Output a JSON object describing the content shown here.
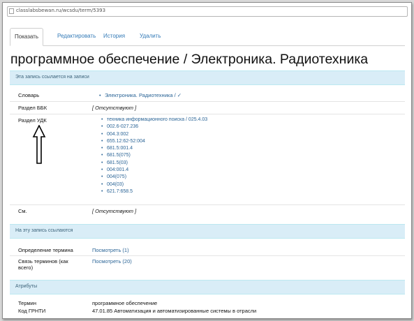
{
  "browser": {
    "url": "classlabsbewan.ru/wcsdu/term/5393"
  },
  "tabs": [
    {
      "label": "Показать"
    },
    {
      "label": "Редактировать"
    },
    {
      "label": "История"
    },
    {
      "label": "Удалить"
    }
  ],
  "page_title": "программное обеспечение / Электроника. Радиотехника",
  "section_refs_out": {
    "header": "Эта запись ссылается на записи",
    "dictionary_label": "Словарь",
    "dictionary_value": "Электроника. Радиотехника / ✓",
    "bbk_label": "Раздел ББК",
    "bbk_value": "[ Отсутствуют ]",
    "udk_label": "Раздел УДК",
    "udk_values": [
      "техника информационного поиска / 025.4.03",
      "002.6-027.236",
      "004.3:002",
      "655.12:62-52:004",
      "681.5:001.4",
      "681.5(075)",
      "681.5(03)",
      "004:001.4",
      "004(075)",
      "004(03)",
      "621.7:658.5"
    ],
    "see_label": "См.",
    "see_value": "[ Отсутствуют ]"
  },
  "section_refs_in": {
    "header": "На эту запись ссылаются",
    "definition_label": "Определение термина",
    "definition_value": "Посмотреть (1)",
    "relation_label_line1": "Связь терминов (как",
    "relation_label_line2": "всего)",
    "relation_value": "Посмотреть (20)"
  },
  "section_attributes": {
    "header": "Атрибуты",
    "term_label": "Термин",
    "term_value": "программное обеспечение",
    "grnti_label": "Код ГРНТИ",
    "grnti_value": "47.01.85 Автоматизация и автоматизированные системы в отрасли"
  },
  "colors": {
    "band_bg": "#d9edf7",
    "link": "#2a6496",
    "tab_link": "#337ab7"
  },
  "icons": {
    "annotation": "up-arrow-outline-icon"
  }
}
